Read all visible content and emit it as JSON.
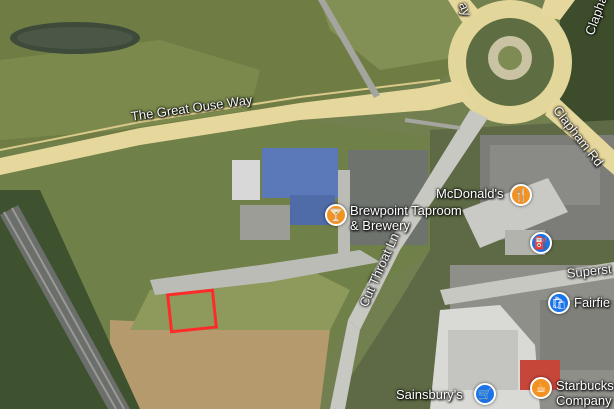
{
  "map_type": "satellite",
  "colors": {
    "road_fill": "#e8dba0",
    "food_pin": "#f29222",
    "shop_pin": "#1a73e8",
    "highlight_box": "#ff2a2a"
  },
  "roads": {
    "great_ouse_way": "The Great Ouse Way",
    "clapham_rd_top": "Clapha",
    "clapham_rd": "Clapham Rd",
    "cut_throat_ln": "Cut Throat Ln",
    "superstore_road": "Superst",
    "way_top": "ay"
  },
  "places": {
    "brewpoint": {
      "name_line1": "Brewpoint Taproom",
      "name_line2": "& Brewery",
      "icon": "cocktail-icon"
    },
    "mcdonalds": {
      "name": "McDonald's",
      "icon": "fork-knife-icon"
    },
    "fuel": {
      "icon": "fuel-pump-icon"
    },
    "fairfield": {
      "name": "Fairfie",
      "icon": "shopping-bag-icon"
    },
    "sainsburys": {
      "name": "Sainsbury's",
      "icon": "shopping-cart-icon"
    },
    "starbucks": {
      "name_line1": "Starbucks",
      "name_line2": "Company",
      "icon": "coffee-icon"
    }
  },
  "highlight": {
    "label": "selected-plot"
  }
}
